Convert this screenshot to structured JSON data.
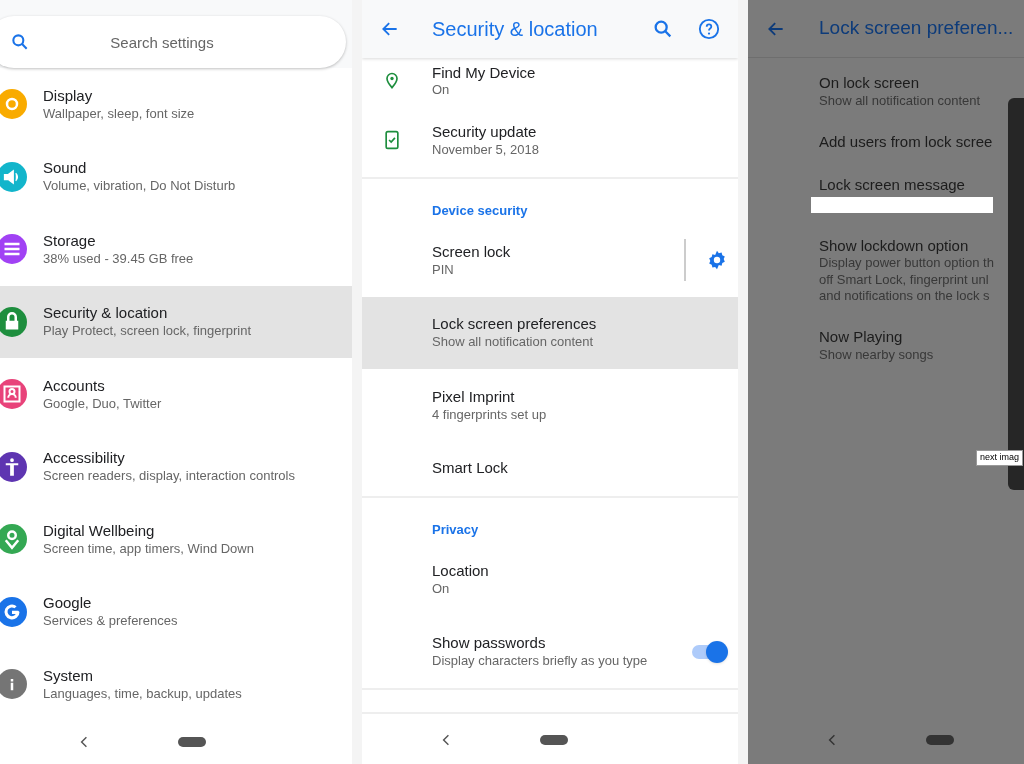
{
  "settings_panel": {
    "search": {
      "placeholder": "Search settings"
    },
    "items": [
      {
        "kind": "display",
        "title": "Display",
        "summary": "Wallpaper, sleep, font size",
        "color": "#f9ab00",
        "selected": false
      },
      {
        "kind": "sound",
        "title": "Sound",
        "summary": "Volume, vibration, Do Not Disturb",
        "color": "#12b5cb",
        "selected": false
      },
      {
        "kind": "storage",
        "title": "Storage",
        "summary": "38% used - 39.45 GB free",
        "color": "#a142f4",
        "selected": false
      },
      {
        "kind": "security",
        "title": "Security & location",
        "summary": "Play Protect, screen lock, fingerprint",
        "color": "#1e8e3e",
        "selected": true
      },
      {
        "kind": "accounts",
        "title": "Accounts",
        "summary": "Google, Duo, Twitter",
        "color": "#e8437a",
        "selected": false
      },
      {
        "kind": "accessibility",
        "title": "Accessibility",
        "summary": "Screen readers, display, interaction controls",
        "color": "#5e35b1",
        "selected": false
      },
      {
        "kind": "wellbeing",
        "title": "Digital Wellbeing",
        "summary": "Screen time, app timers, Wind Down",
        "color": "#34a853",
        "selected": false
      },
      {
        "kind": "google",
        "title": "Google",
        "summary": "Services & preferences",
        "color": "#1a73e8",
        "selected": false
      },
      {
        "kind": "system",
        "title": "System",
        "summary": "Languages, time, backup, updates",
        "color": "#757575",
        "selected": false
      }
    ]
  },
  "security_panel": {
    "title": "Security & location",
    "sections": [
      {
        "items": [
          {
            "kind": "pin",
            "title": "Find My Device",
            "summary": "On",
            "selected": false
          },
          {
            "kind": "phone",
            "title": "Security update",
            "summary": "November 5, 2018",
            "selected": false
          }
        ]
      },
      {
        "header": "Device security",
        "items": [
          {
            "kind": "gear",
            "title": "Screen lock",
            "summary": "PIN",
            "selected": false
          },
          {
            "kind": "plain",
            "title": "Lock screen preferences",
            "summary": "Show all notification content",
            "selected": true
          },
          {
            "kind": "plain",
            "title": "Pixel Imprint",
            "summary": "4 fingerprints set up",
            "selected": false
          },
          {
            "kind": "plain",
            "title": "Smart Lock",
            "selected": false
          }
        ]
      },
      {
        "header": "Privacy",
        "items": [
          {
            "kind": "plain",
            "title": "Location",
            "summary": "On",
            "selected": false
          },
          {
            "kind": "switch",
            "title": "Show passwords",
            "summary": "Display characters briefly as you type",
            "on": true,
            "selected": false
          }
        ]
      }
    ]
  },
  "lock_panel": {
    "title": "Lock screen preferen...",
    "items": [
      {
        "title": "On lock screen",
        "summary": [
          "Show all notification content"
        ]
      },
      {
        "title": "Add users from lock scree"
      },
      {
        "title": "Lock screen message",
        "redacted": true
      },
      {
        "title": "Show lockdown option",
        "summary": [
          "Display power button option th",
          "off Smart Lock, fingerprint unl",
          "and notifications on the lock s"
        ]
      },
      {
        "title": "Now Playing",
        "summary": [
          "Show nearby songs"
        ]
      }
    ],
    "tooltip": "next imag"
  }
}
